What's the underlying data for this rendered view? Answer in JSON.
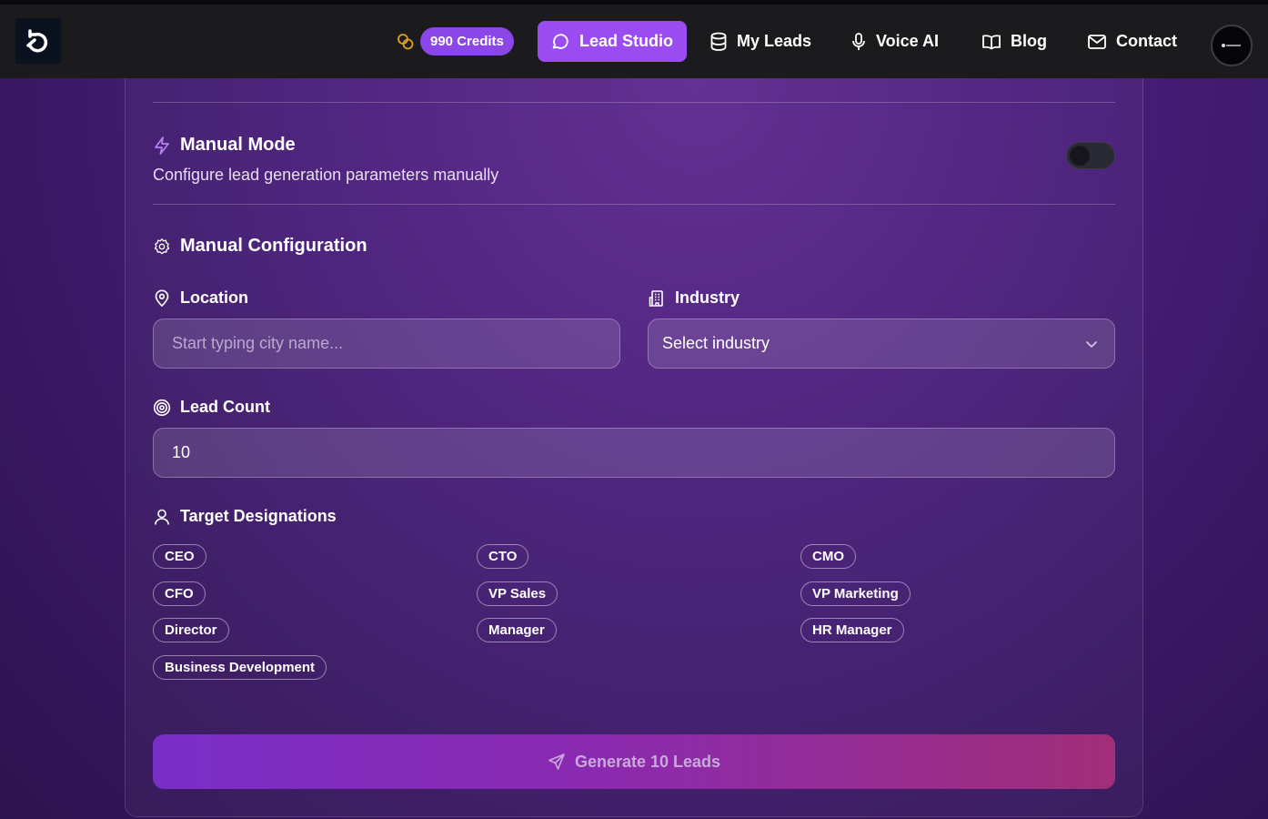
{
  "nav": {
    "credits": "990 Credits",
    "items": [
      {
        "label": "Lead Studio",
        "icon": "chat-bubble-icon",
        "active": true
      },
      {
        "label": "My Leads",
        "icon": "database-icon",
        "active": false
      },
      {
        "label": "Voice AI",
        "icon": "microphone-icon",
        "active": false
      },
      {
        "label": "Blog",
        "icon": "book-open-icon",
        "active": false
      },
      {
        "label": "Contact",
        "icon": "mail-icon",
        "active": false
      }
    ]
  },
  "manual_mode": {
    "title": "Manual Mode",
    "description": "Configure lead generation parameters manually",
    "enabled": false
  },
  "config": {
    "title": "Manual Configuration",
    "location": {
      "label": "Location",
      "placeholder": "Start typing city name..."
    },
    "industry": {
      "label": "Industry",
      "selected": "Select industry"
    },
    "lead_count": {
      "label": "Lead Count",
      "value": "10"
    },
    "designations": {
      "label": "Target Designations",
      "chips": [
        "CEO",
        "CTO",
        "CMO",
        "CFO",
        "VP Sales",
        "VP Marketing",
        "Director",
        "Manager",
        "HR Manager",
        "Business Development"
      ]
    }
  },
  "generate_button": "Generate 10 Leads",
  "colors": {
    "accent": "#9a4cf2",
    "credits_badge": "#8b46e8",
    "coin_icon": "#e0a020",
    "topbar": "#1b1b1e"
  }
}
